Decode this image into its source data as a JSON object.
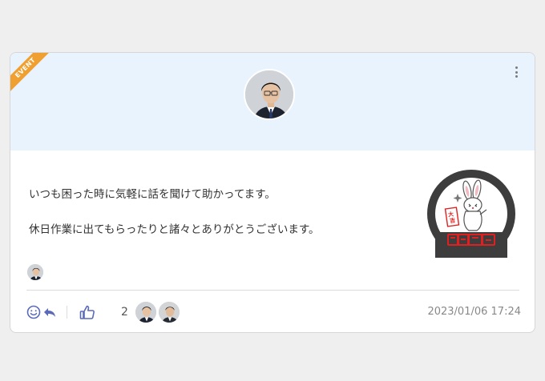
{
  "card": {
    "badge": "EVENT",
    "menu_icon": "kebab-menu-icon",
    "sender_avatar": "person-photo-avatar",
    "message_lines": [
      "いつも困った時に気軽に話を聞けて助かってます。",
      "休日作業に出てもらったりと諸々とありがとうございます。"
    ],
    "stamp_icon": "rabbit-omikuji-stamp",
    "recipient_avatar": "person-photo-avatar"
  },
  "actions": {
    "reaction_icon": "smile-icon",
    "reply_icon": "reply-arrow-icon",
    "like_icon": "thumbs-up-icon",
    "like_count": "2",
    "reactors": [
      "person-photo-avatar",
      "person-photo-avatar"
    ],
    "timestamp": "2023/01/06 17:24"
  },
  "colors": {
    "header_bg": "#e9f3fd",
    "badge": "#f0a030",
    "icon_accent": "#5a6ab8",
    "stamp_ring": "#3d3d3d",
    "stamp_red": "#e02020"
  }
}
